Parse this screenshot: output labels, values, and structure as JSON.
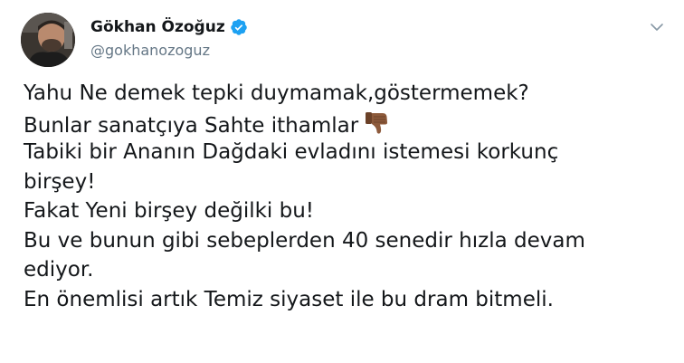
{
  "author": {
    "display_name": "Gökhan Özoğuz",
    "handle": "@gokhanozoguz",
    "verified": true
  },
  "icons": {
    "verified": "verified-badge-icon",
    "menu": "chevron-down-icon",
    "emoji": "thumbs-down-medium-dark-skin-tone-emoji"
  },
  "colors": {
    "verified_blue": "#1da1f2",
    "text": "#14171a",
    "secondary_text": "#657786",
    "emoji_skin": "#8d5a3b"
  },
  "tweet": {
    "lines": [
      "Yahu Ne demek tepki duymamak,göstermemek?",
      "Bunlar sanatçıya Sahte ithamlar",
      "Tabiki bir Ananın Dağdaki evladını istemesi korkunç",
      "birşey!",
      "Fakat Yeni birşey değilki bu!",
      "Bu ve bunun gibi sebeplerden 40 senedir hızla devam",
      "ediyor.",
      "En önemlisi artık Temiz  siyaset ile bu dram bitmeli."
    ]
  }
}
